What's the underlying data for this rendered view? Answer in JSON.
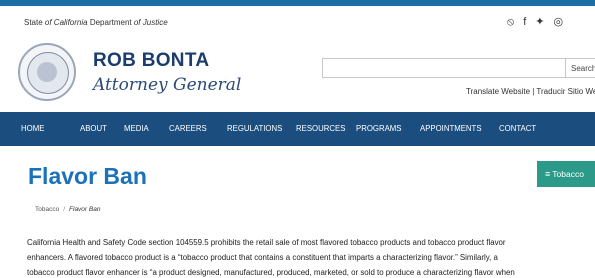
{
  "header": {
    "agency_prefix": "State ",
    "agency_state": "of California",
    "agency_suffix": " Department ",
    "agency_of": "of Justice",
    "name": "ROB BONTA",
    "title": "Attorney General",
    "search_placeholder": "",
    "search_button": "Search",
    "translate": "Translate Website | Traducir Sitio Web"
  },
  "social_icons": [
    "rss-icon",
    "facebook-icon",
    "twitter-icon",
    "instagram-icon"
  ],
  "social_glyphs": [
    "⦸",
    "f",
    "✦",
    "◎"
  ],
  "nav": {
    "items": [
      "HOME",
      "ABOUT",
      "MEDIA",
      "CAREERS",
      "REGULATIONS",
      "RESOURCES",
      "PROGRAMS",
      "APPOINTMENTS",
      "CONTACT"
    ]
  },
  "page": {
    "title": "Flavor Ban",
    "section_button": "Tobacco",
    "breadcrumb": {
      "parent": "Tobacco",
      "separator": "/",
      "current": "Flavor Ban"
    },
    "paragraph_lines": [
      "California Health and Safety Code section 104559.5 prohibits the retail sale of most flavored tobacco products and tobacco product flavor",
      "enhancers. A flavored tobacco product is a “tobacco product that contains a constituent that imparts a characterizing flavor.” Similarly, a",
      "tobacco product flavor enhancer is “a product designed, manufactured, produced, marketed, or sold to produce a characterizing flavor when"
    ]
  },
  "colors": {
    "top_bar": "#1b6fa5",
    "nav_bg": "#1b4e7f",
    "title_blue": "#1b72b8",
    "button_teal": "#2c9a89"
  }
}
